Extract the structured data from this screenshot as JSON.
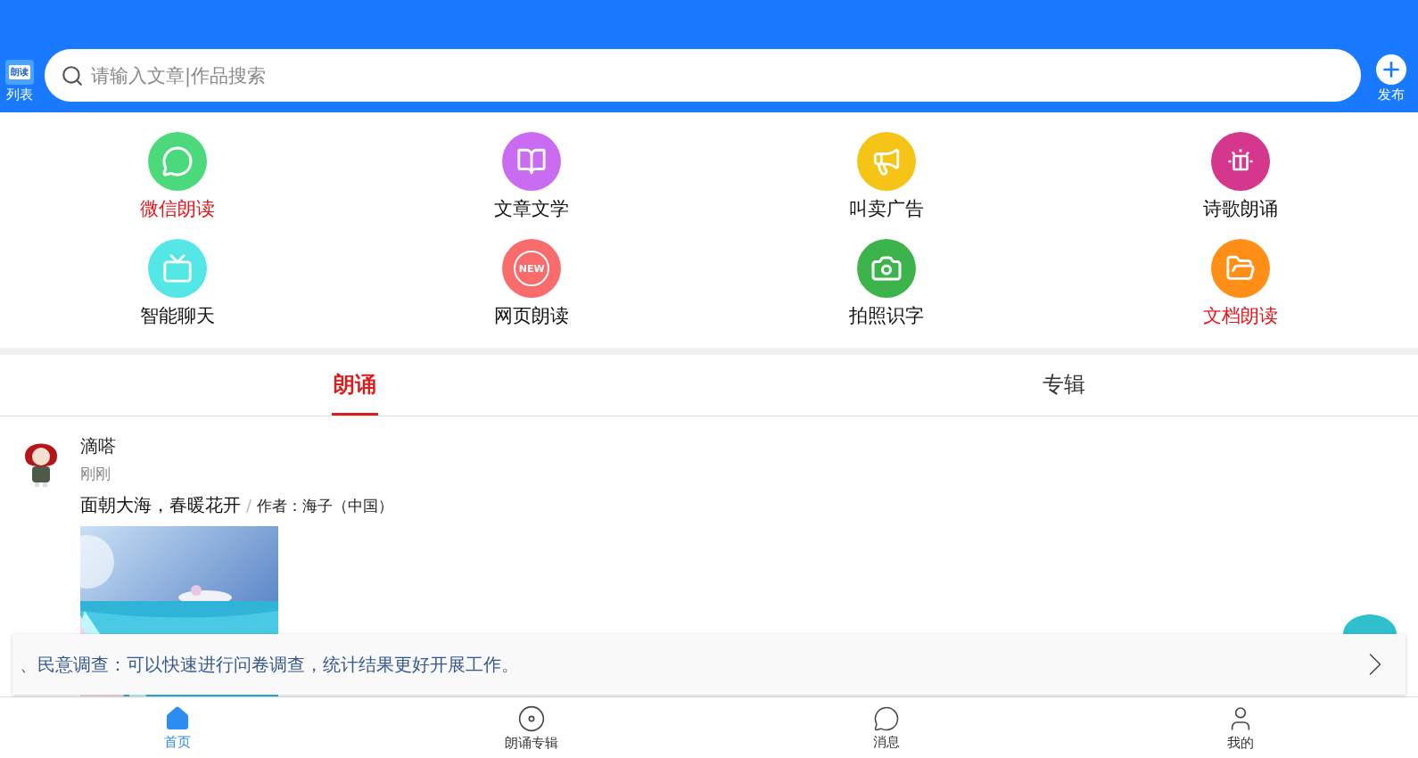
{
  "header": {
    "list_label": "列表",
    "list_logo_text": "朗读",
    "search": {
      "placeholder": "请输入文章|作品搜索"
    },
    "publish_label": "发布"
  },
  "shortcuts": [
    {
      "label": "微信朗读",
      "color": "#4cd97b",
      "highlighted": true
    },
    {
      "label": "文章文学",
      "color": "#c96cf2",
      "highlighted": false
    },
    {
      "label": "叫卖广告",
      "color": "#f5c417",
      "highlighted": false
    },
    {
      "label": "诗歌朗诵",
      "color": "#d4378b",
      "highlighted": false
    },
    {
      "label": "智能聊天",
      "color": "#55e6e6",
      "highlighted": false
    },
    {
      "label": "网页朗读",
      "color": "#fa6b6b",
      "highlighted": false,
      "badge": "NEW"
    },
    {
      "label": "拍照识字",
      "color": "#3cb44b",
      "highlighted": false
    },
    {
      "label": "文档朗读",
      "color": "#ff8f17",
      "highlighted": true
    }
  ],
  "tabs": [
    {
      "label": "朗诵",
      "selected": true
    },
    {
      "label": "专辑",
      "selected": false
    }
  ],
  "post": {
    "author": "滴嗒",
    "time": "刚刚",
    "title": "面朝大海，春暖花开",
    "separator": "/",
    "byline": "作者：海子（中国）"
  },
  "banner": {
    "text": "、民意调查：可以快速进行问卷调查，统计结果更好开展工作。"
  },
  "bottom_nav": [
    {
      "label": "首页",
      "selected": true
    },
    {
      "label": "朗诵专辑",
      "selected": false
    },
    {
      "label": "消息",
      "selected": false
    },
    {
      "label": "我的",
      "selected": false
    }
  ]
}
